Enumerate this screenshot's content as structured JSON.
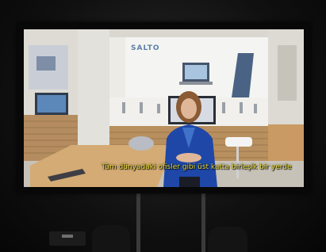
{
  "screen": {
    "brand_logo": "SALTO",
    "subtitle": "Tüm dünyadaki ofisler gibi üst katta birleşik bir yerde"
  }
}
